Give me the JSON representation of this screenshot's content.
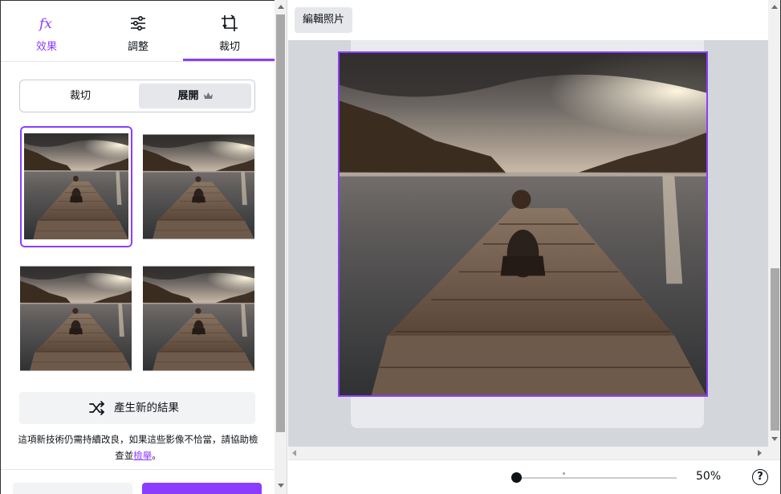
{
  "tabs": [
    {
      "label": "效果",
      "icon": "fx-icon"
    },
    {
      "label": "調整",
      "icon": "sliders-icon"
    },
    {
      "label": "裁切",
      "icon": "crop-icon"
    }
  ],
  "active_tab": "裁切",
  "segmented": {
    "crop_label": "裁切",
    "expand_label": "展開"
  },
  "generate_button_label": "產生新的結果",
  "notice": {
    "text": "這項新技術仍需持續改良，如果這些影像不恰當，請協助檢查並",
    "link": "檢舉",
    "end": "。"
  },
  "topbar": {
    "edit_photo_label": "編輯照片"
  },
  "zoom": {
    "value_label": "50%",
    "value": 0.5
  },
  "help_label": "?",
  "colors": {
    "accent": "#8b3dff",
    "panel_bg": "#ffffff",
    "canvas_bg": "#d3d6db"
  }
}
